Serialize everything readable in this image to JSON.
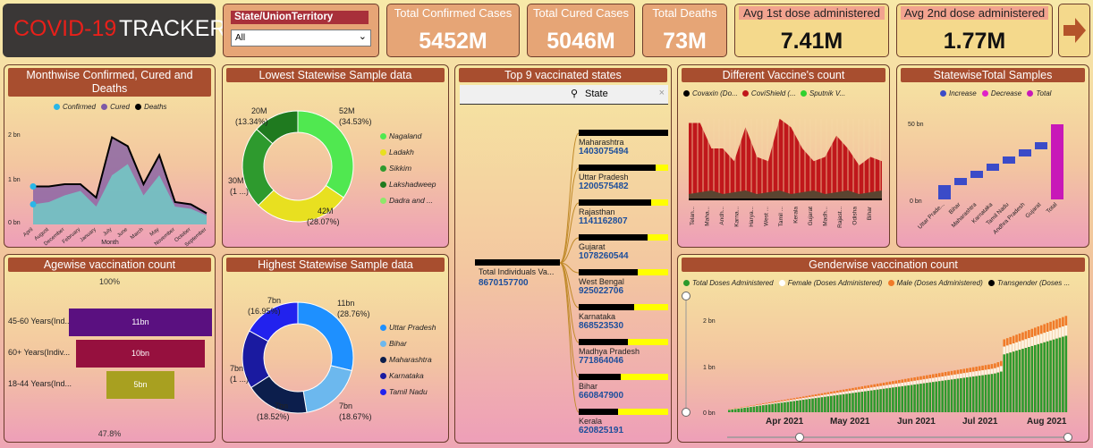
{
  "title": {
    "part1": "COVID-19",
    "part2": "TRACKER"
  },
  "slicer": {
    "label": "State/UnionTerritory",
    "value": "All"
  },
  "kpis": [
    {
      "label": "Total Confirmed Cases",
      "value": "5452M"
    },
    {
      "label": "Total Cured Cases",
      "value": "5046M"
    },
    {
      "label": "Total Deaths",
      "value": "73M"
    }
  ],
  "kpis2": [
    {
      "label": "Avg 1st dose administered",
      "value": "7.41M"
    },
    {
      "label": "Avg 2nd dose administered",
      "value": "1.77M"
    }
  ],
  "monthwise": {
    "title": "Monthwise Confirmed, Cured and Deaths",
    "legend": [
      "Confirmed",
      "Cured",
      "Deaths"
    ],
    "colors": [
      "#29b6e8",
      "#7e5aa6",
      "#000000"
    ],
    "xlabel": "Month",
    "yticks": [
      "2 bn",
      "1 bn",
      "0 bn"
    ],
    "months": [
      "April",
      "August",
      "December",
      "February",
      "January",
      "July",
      "June",
      "March",
      "May",
      "November",
      "October",
      "September"
    ],
    "confirmed": [
      0.85,
      0.85,
      0.9,
      0.9,
      0.6,
      1.95,
      1.75,
      0.9,
      1.55,
      0.5,
      0.45,
      0.25
    ],
    "cured": [
      0.45,
      0.5,
      0.65,
      0.75,
      0.4,
      1.1,
      1.35,
      0.65,
      1.1,
      0.4,
      0.35,
      0.2
    ]
  },
  "lowest": {
    "title": "Lowest Statewise Sample data",
    "legend": [
      "Nagaland",
      "Ladakh",
      "Sikkim",
      "Lakshadweep",
      "Dadra and ..."
    ],
    "colors": [
      "#50e850",
      "#e8e020",
      "#2e9a2e",
      "#1f7a1f",
      "#8ee86a"
    ],
    "labels": [
      {
        "v": "52M",
        "p": "(34.53%)"
      },
      {
        "v": "42M",
        "p": "(28.07%)"
      },
      {
        "v": "30M",
        "p": "(1 ...)"
      },
      {
        "v": "20M",
        "p": "(13.34%)"
      }
    ]
  },
  "top9": {
    "title": "Top 9 vaccinated states",
    "search": "State",
    "root_label": "Total Individuals Va...",
    "root_value": "8670157700",
    "states": [
      {
        "name": "Maharashtra",
        "value": "1403075494",
        "frac": 1.0
      },
      {
        "name": "Uttar Pradesh",
        "value": "1200575482",
        "frac": 0.86
      },
      {
        "name": "Rajasthan",
        "value": "1141162807",
        "frac": 0.81
      },
      {
        "name": "Gujarat",
        "value": "1078260544",
        "frac": 0.77
      },
      {
        "name": "West Bengal",
        "value": "925022706",
        "frac": 0.66
      },
      {
        "name": "Karnataka",
        "value": "868523530",
        "frac": 0.62
      },
      {
        "name": "Madhya Pradesh",
        "value": "771864046",
        "frac": 0.55
      },
      {
        "name": "Bihar",
        "value": "660847900",
        "frac": 0.47
      },
      {
        "name": "Kerala",
        "value": "620825191",
        "frac": 0.44
      }
    ]
  },
  "vaccines": {
    "title": "Different Vaccine's count",
    "legend": [
      "Covaxin (Do...",
      "CoviShield (...",
      "Sputnik V..."
    ],
    "colors": [
      "#000000",
      "#c0171b",
      "#2fd12f"
    ],
    "states": [
      "Telan...",
      "Maha...",
      "Andh...",
      "Karna...",
      "Harya...",
      "West ...",
      "Tamil ...",
      "Kerala",
      "Gujarat",
      "Madh...",
      "Rajast...",
      "Odisha",
      "Bihar"
    ]
  },
  "samples": {
    "title": "StatewiseTotal Samples",
    "legend": [
      "Increase",
      "Decrease",
      "Total"
    ],
    "colors": [
      "#3b4bc8",
      "#e020c8",
      "#c818b8"
    ],
    "yticks": [
      "50 bn",
      "0 bn"
    ],
    "categories": [
      "Uttar Prade...",
      "Bihar",
      "Maharashtra",
      "Karnataka",
      "Tamil Nadu",
      "Andhra Pradesh",
      "Gujarat",
      "Total"
    ]
  },
  "agewise": {
    "title": "Agewise vaccination count",
    "top": "100%",
    "bottom": "47.8%",
    "rows": [
      {
        "label": "45-60 Years(Ind...",
        "value": "11bn",
        "frac": 1.0,
        "color": "#5a1080"
      },
      {
        "label": "60+ Years(Indiv...",
        "value": "10bn",
        "frac": 0.9,
        "color": "#96103e"
      },
      {
        "label": "18-44 Years(Ind...",
        "value": "5bn",
        "frac": 0.478,
        "color": "#a8a020"
      }
    ]
  },
  "highest": {
    "title": "Highest Statewise Sample data",
    "legend": [
      "Uttar Pradesh",
      "Bihar",
      "Maharashtra",
      "Karnataka",
      "Tamil Nadu"
    ],
    "colors": [
      "#1e90ff",
      "#6cb8ee",
      "#0c1e4c",
      "#1a1aa0",
      "#2222ee"
    ],
    "labels": [
      {
        "v": "11bn",
        "p": "(28.76%)"
      },
      {
        "v": "7bn",
        "p": "(18.67%)"
      },
      {
        "v": "7bn",
        "p": "(18.52%)"
      },
      {
        "v": "7bn",
        "p": "(1 ...)"
      },
      {
        "v": "7bn",
        "p": "(16.95%)"
      }
    ]
  },
  "gender": {
    "title": "Genderwise vaccination count",
    "legend": [
      "Total Doses Administered",
      "Female (Doses Administered)",
      "Male (Doses Administered)",
      "Transgender (Doses ..."
    ],
    "colors": [
      "#2c9a2c",
      "#ffffff",
      "#f07a28",
      "#000000"
    ],
    "yticks": [
      "2 bn",
      "1 bn",
      "0 bn"
    ],
    "xticks": [
      "Apr 2021",
      "May 2021",
      "Jun 2021",
      "Jul 2021",
      "Aug 2021"
    ]
  }
}
